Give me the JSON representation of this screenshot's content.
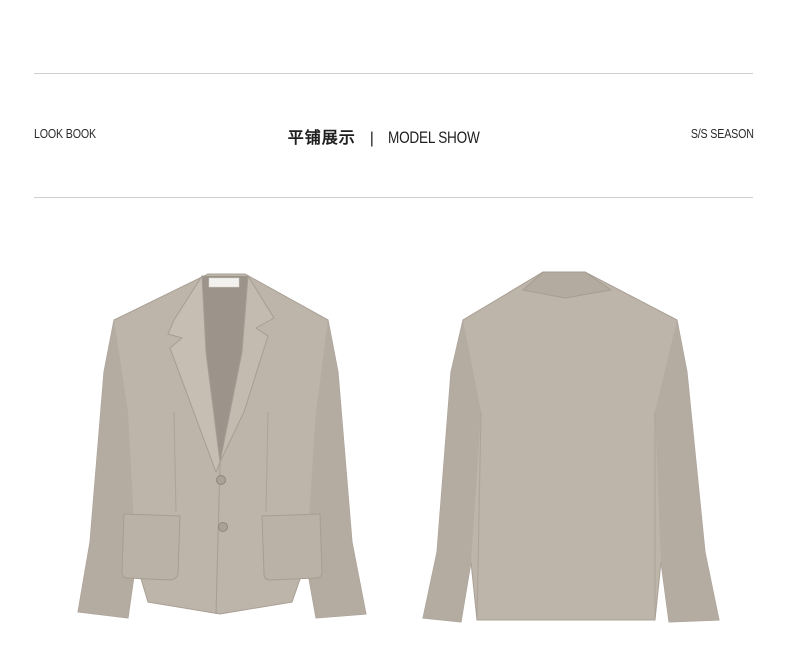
{
  "header": {
    "left_label": "LOOK BOOK",
    "title_cn": "平铺展示",
    "separator": "|",
    "title_en": "MODEL SHOW",
    "right_label": "S/S SEASON"
  },
  "colors": {
    "fabric": "#bdb4aa",
    "fabric_shadow": "#a69d93",
    "fabric_dark": "#8f877e",
    "inner_lining": "#9c948a",
    "rule": "#cfcfcf"
  },
  "images": [
    {
      "name": "blazer-front-view"
    },
    {
      "name": "blazer-back-view"
    }
  ]
}
